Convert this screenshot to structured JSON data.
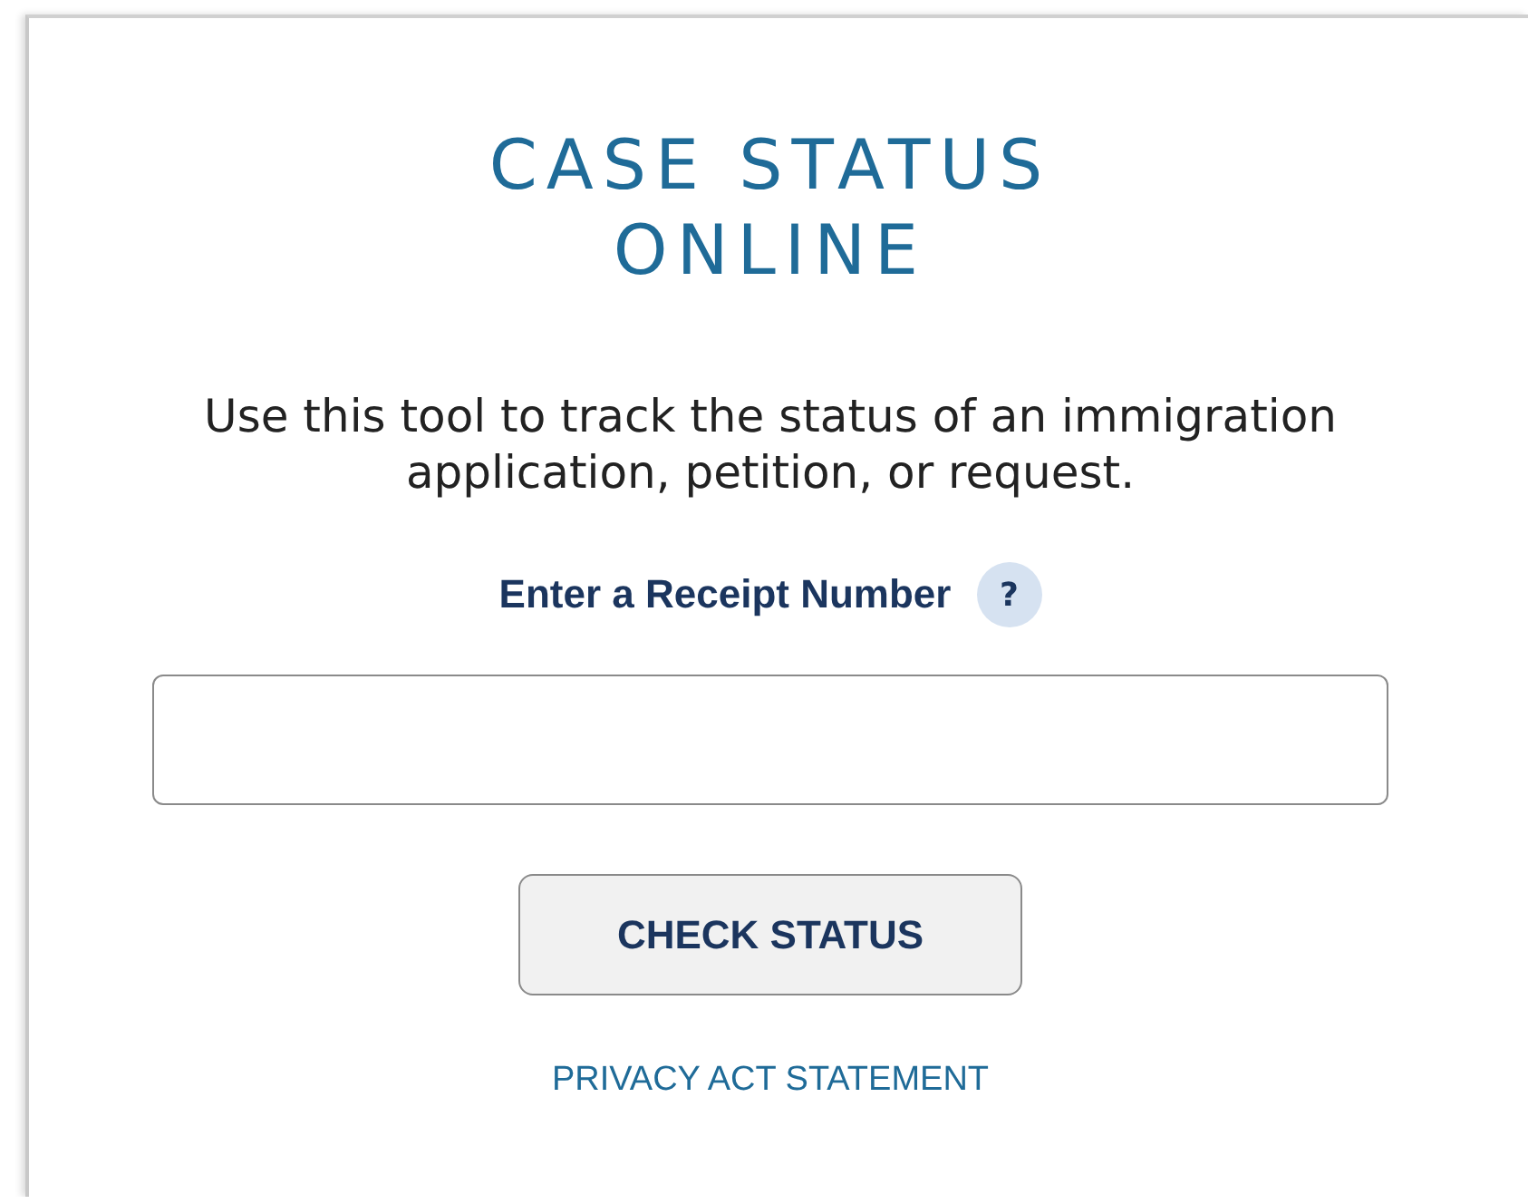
{
  "title_lines": [
    "CASE STATUS",
    "ONLINE"
  ],
  "description": "Use this tool to track the status of an immigration application, petition, or request.",
  "receipt_field": {
    "label": "Enter a Receipt Number",
    "help": "?"
  },
  "button": "CHECK STATUS",
  "link": "PRIVACY ACT STATEMENT"
}
